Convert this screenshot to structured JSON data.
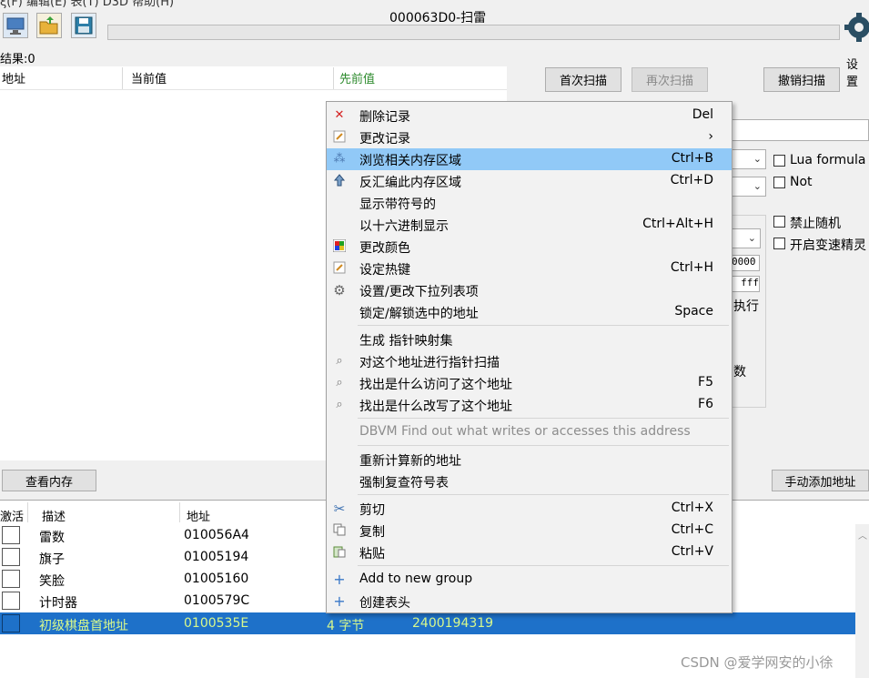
{
  "window": {
    "title": "000063D0-扫雷",
    "top_menu_fragment": "ξ(F)  编辑(E)  表(T)  D3D  帮助(H)",
    "settings_label": "设置",
    "results_label": "结果:0"
  },
  "scan": {
    "headers": {
      "address": "地址",
      "current": "当前值",
      "previous": "先前值"
    },
    "first_scan": "首次扫描",
    "next_scan": "再次扫描",
    "undo_scan": "撤销扫描",
    "view_memory": "查看内存",
    "add_address_manually": "手动添加地址"
  },
  "options": {
    "lua_formula": "Lua formula",
    "not": "Not",
    "disable_random": "禁止随机",
    "speedhack": "开启变速精灵",
    "hex_start": "0000",
    "hex_end": "fff",
    "execute_label": "执行",
    "frag_shu": "数"
  },
  "context_menu": {
    "items": [
      {
        "icon": "delete-icon",
        "label": "删除记录",
        "shortcut": "Del"
      },
      {
        "icon": "edit-icon",
        "label": "更改记录",
        "shortcut": "›"
      },
      {
        "icon": "browse-memory-icon",
        "label": "浏览相关内存区域",
        "shortcut": "Ctrl+B"
      },
      {
        "icon": "disassemble-icon",
        "label": "反汇编此内存区域",
        "shortcut": "Ctrl+D"
      },
      {
        "icon": "",
        "label": "显示带符号的",
        "shortcut": ""
      },
      {
        "icon": "",
        "label": "以十六进制显示",
        "shortcut": "Ctrl+Alt+H"
      },
      {
        "icon": "color-icon",
        "label": "更改颜色",
        "shortcut": ""
      },
      {
        "icon": "hotkey-icon",
        "label": "设定热键",
        "shortcut": "Ctrl+H"
      },
      {
        "icon": "gear-icon",
        "label": "设置/更改下拉列表项",
        "shortcut": ""
      },
      {
        "icon": "",
        "label": "锁定/解锁选中的地址",
        "shortcut": "Space"
      },
      {
        "icon": "",
        "label": "生成 指针映射集",
        "shortcut": ""
      },
      {
        "icon": "pointer-scan-icon",
        "label": "对这个地址进行指针扫描",
        "shortcut": ""
      },
      {
        "icon": "find-access-icon",
        "label": "找出是什么访问了这个地址",
        "shortcut": "F5"
      },
      {
        "icon": "find-write-icon",
        "label": "找出是什么改写了这个地址",
        "shortcut": "F6"
      },
      {
        "icon": "",
        "label": "DBVM Find out what writes or accesses this address",
        "shortcut": ""
      },
      {
        "icon": "",
        "label": "重新计算新的地址",
        "shortcut": ""
      },
      {
        "icon": "",
        "label": "强制复查符号表",
        "shortcut": ""
      },
      {
        "icon": "cut-icon",
        "label": "剪切",
        "shortcut": "Ctrl+X"
      },
      {
        "icon": "copy-icon",
        "label": "复制",
        "shortcut": "Ctrl+C"
      },
      {
        "icon": "paste-icon",
        "label": "粘贴",
        "shortcut": "Ctrl+V"
      },
      {
        "icon": "plus-icon",
        "label": "Add to new group",
        "shortcut": ""
      },
      {
        "icon": "plus-icon",
        "label": "创建表头",
        "shortcut": ""
      }
    ]
  },
  "address_table": {
    "headers": {
      "active": "激活",
      "description": "描述",
      "address": "地址"
    },
    "rows": [
      {
        "desc": "雷数",
        "addr": "010056A4",
        "type": "",
        "value": ""
      },
      {
        "desc": "旗子",
        "addr": "01005194",
        "type": "",
        "value": ""
      },
      {
        "desc": "笑脸",
        "addr": "01005160",
        "type": "",
        "value": ""
      },
      {
        "desc": "计时器",
        "addr": "0100579C",
        "type": "",
        "value": ""
      },
      {
        "desc": "初级棋盘首地址",
        "addr": "0100535E",
        "type": "4 字节",
        "value": "2400194319"
      }
    ]
  },
  "watermark": "CSDN @爱学网安的小徐",
  "colors": {
    "highlight": "#91c9f7",
    "selection": "#1e71c9",
    "selection_text": "#d8f88c",
    "prev_value_header": "#2e8b2e"
  }
}
